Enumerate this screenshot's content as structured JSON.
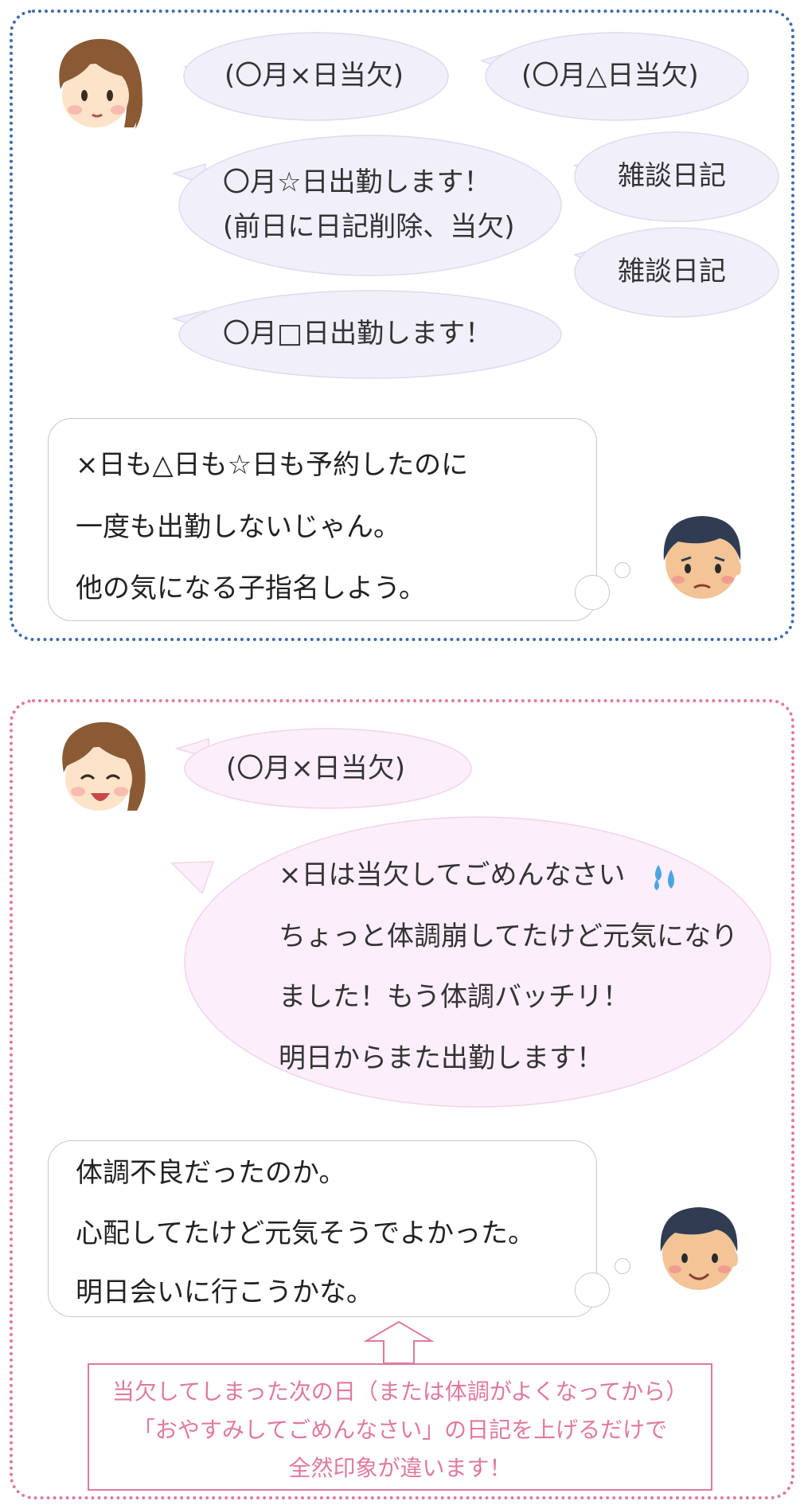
{
  "colors": {
    "panel1_border": "#3f6aa8",
    "panel2_border": "#e0799f",
    "bubble1_fill": "#f0effa",
    "bubble2_fill": "#fceefa",
    "tip_text": "#e0799f"
  },
  "panel1": {
    "woman_icon": "woman-neutral-face",
    "man_icon": "man-worried-face",
    "bubbles": [
      "(〇月×日当欠)",
      "(〇月△日当欠)",
      "〇月☆日出勤します！",
      "(前日に日記削除、当欠)",
      "雑談日記",
      "雑談日記",
      "〇月□日出勤します！"
    ],
    "thought": [
      "×日も△日も☆日も予約したのに",
      "一度も出勤しないじゃん。",
      "他の気になる子指名しよう。"
    ]
  },
  "panel2": {
    "woman_icon": "woman-smiling-face",
    "man_icon": "man-happy-face",
    "bubble_small": "(〇月×日当欠)",
    "bubble_big": [
      "×日は当欠してごめんなさい",
      "ちょっと体調崩してたけど元気になり",
      "ました！もう体調バッチリ！",
      "明日からまた出勤します！"
    ],
    "sweat_icon": "sweat-drops-icon",
    "thought": [
      "体調不良だったのか。",
      "心配してたけど元気そうでよかった。",
      "明日会いに行こうかな。"
    ],
    "tip": [
      "当欠してしまった次の日（または体調がよくなってから）",
      "「おやすみしてごめんなさい」の日記を上げるだけで",
      "全然印象が違います！"
    ]
  }
}
